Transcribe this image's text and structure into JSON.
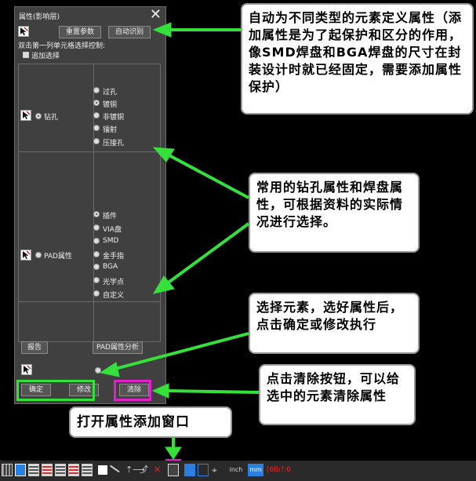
{
  "panel": {
    "title": "属性(影响层)",
    "reset_label": "重置参数",
    "auto_label": "自动识别",
    "instruction": "双击第一列单元格选择控制:",
    "append_label": "追加选择",
    "drill": {
      "label": "钻孔",
      "options": [
        "过孔",
        "镀铜",
        "非镀铜",
        "镭射",
        "压接孔"
      ],
      "selected": "镀铜"
    },
    "pad": {
      "label": "PAD属性",
      "options": [
        "插件",
        "VIA盘",
        "SMD",
        "金手指",
        "BGA",
        "光学点",
        "自定义"
      ],
      "selected": "插件"
    },
    "report_label": "报告",
    "pad_analysis_label": "PAD属性分析",
    "confirm_label": "确定",
    "modify_label": "修改",
    "clear_label": "清除"
  },
  "callouts": {
    "auto": "自动为不同类型的元素定义属性（添加属性是为了起保护和区分的作用，像SMD焊盘和BGA焊盘的尺寸在封装设计时就已经固定，需要添加属性保护）",
    "common": "常用的钻孔属性和焊盘属性，可根据资料的实际情况进行选择。",
    "select": "选择元素，选好属性后，点击确定或修改执行",
    "clear": "点击清除按钮，可以给选中的元素清除属性",
    "open": "打开属性添加窗口"
  },
  "toolbar": {
    "inch_label": "inch",
    "mm_label": "mm",
    "status_text": "[6lb?:0"
  },
  "colors": {
    "green": "#35e03a",
    "magenta": "#e020c8",
    "blue": "#2b7fe0",
    "red": "#ff2020"
  }
}
